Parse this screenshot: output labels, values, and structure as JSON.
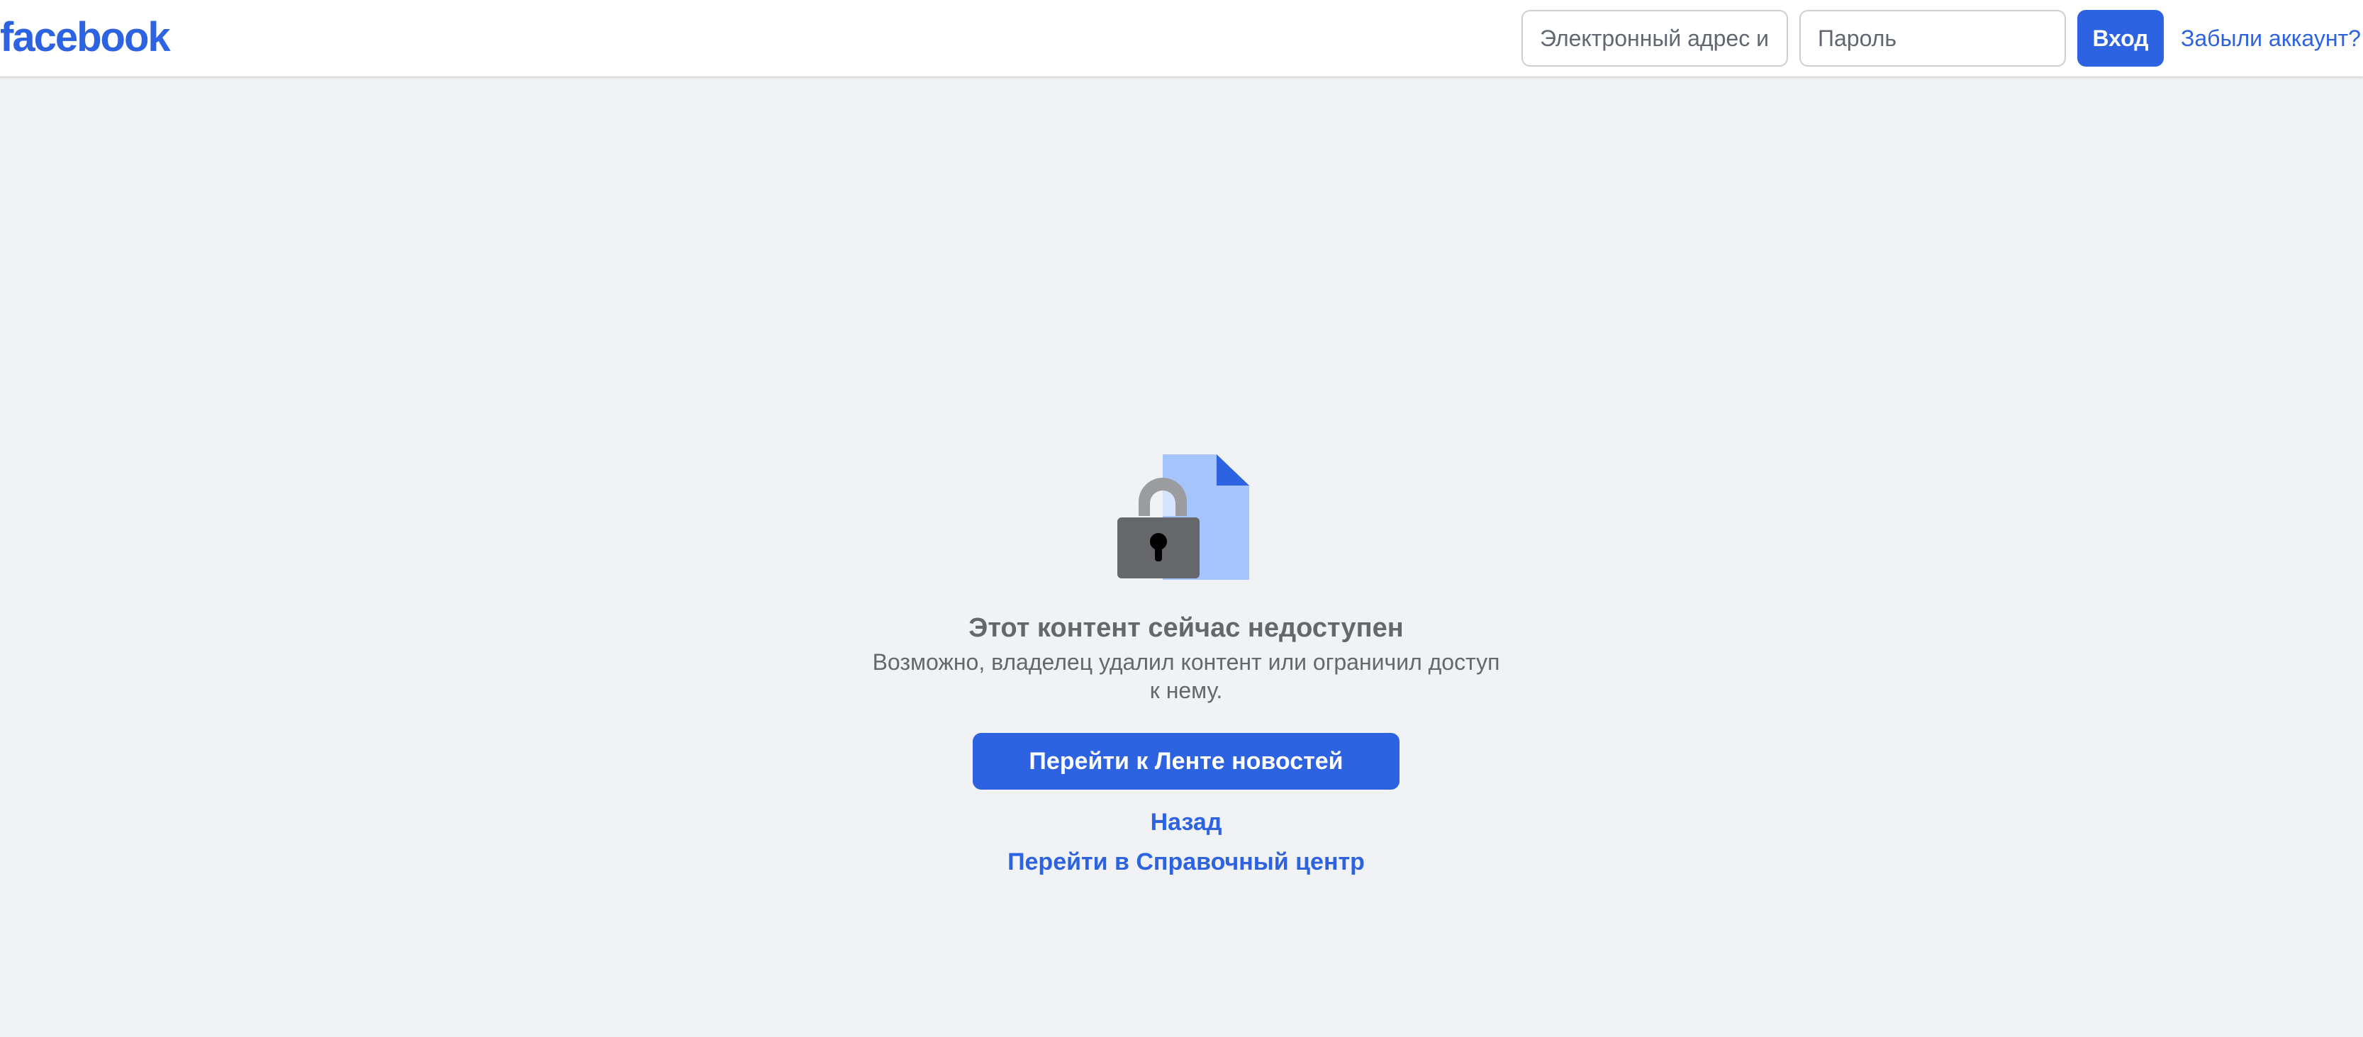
{
  "header": {
    "logo_text": "facebook",
    "email_placeholder": "Электронный адрес и...",
    "password_placeholder": "Пароль",
    "login_label": "Вход",
    "forgot_label": "Забыли аккаунт?"
  },
  "main": {
    "illustration_icon": "locked-document-icon",
    "title": "Этот контент сейчас недоступен",
    "description": "Возможно, владелец удалил контент или ограничил доступ к нему.",
    "news_feed_button": "Перейти к Ленте новостей",
    "back_link": "Назад",
    "help_center_link": "Перейти в Справочный центр"
  },
  "colors": {
    "brand_blue": "#2d62e0",
    "background": "#f0f2f5",
    "text_secondary": "#65676b",
    "document_blue": "#a4c4fb",
    "lock_body": "#65676b",
    "lock_shackle": "#9a9ca0"
  }
}
